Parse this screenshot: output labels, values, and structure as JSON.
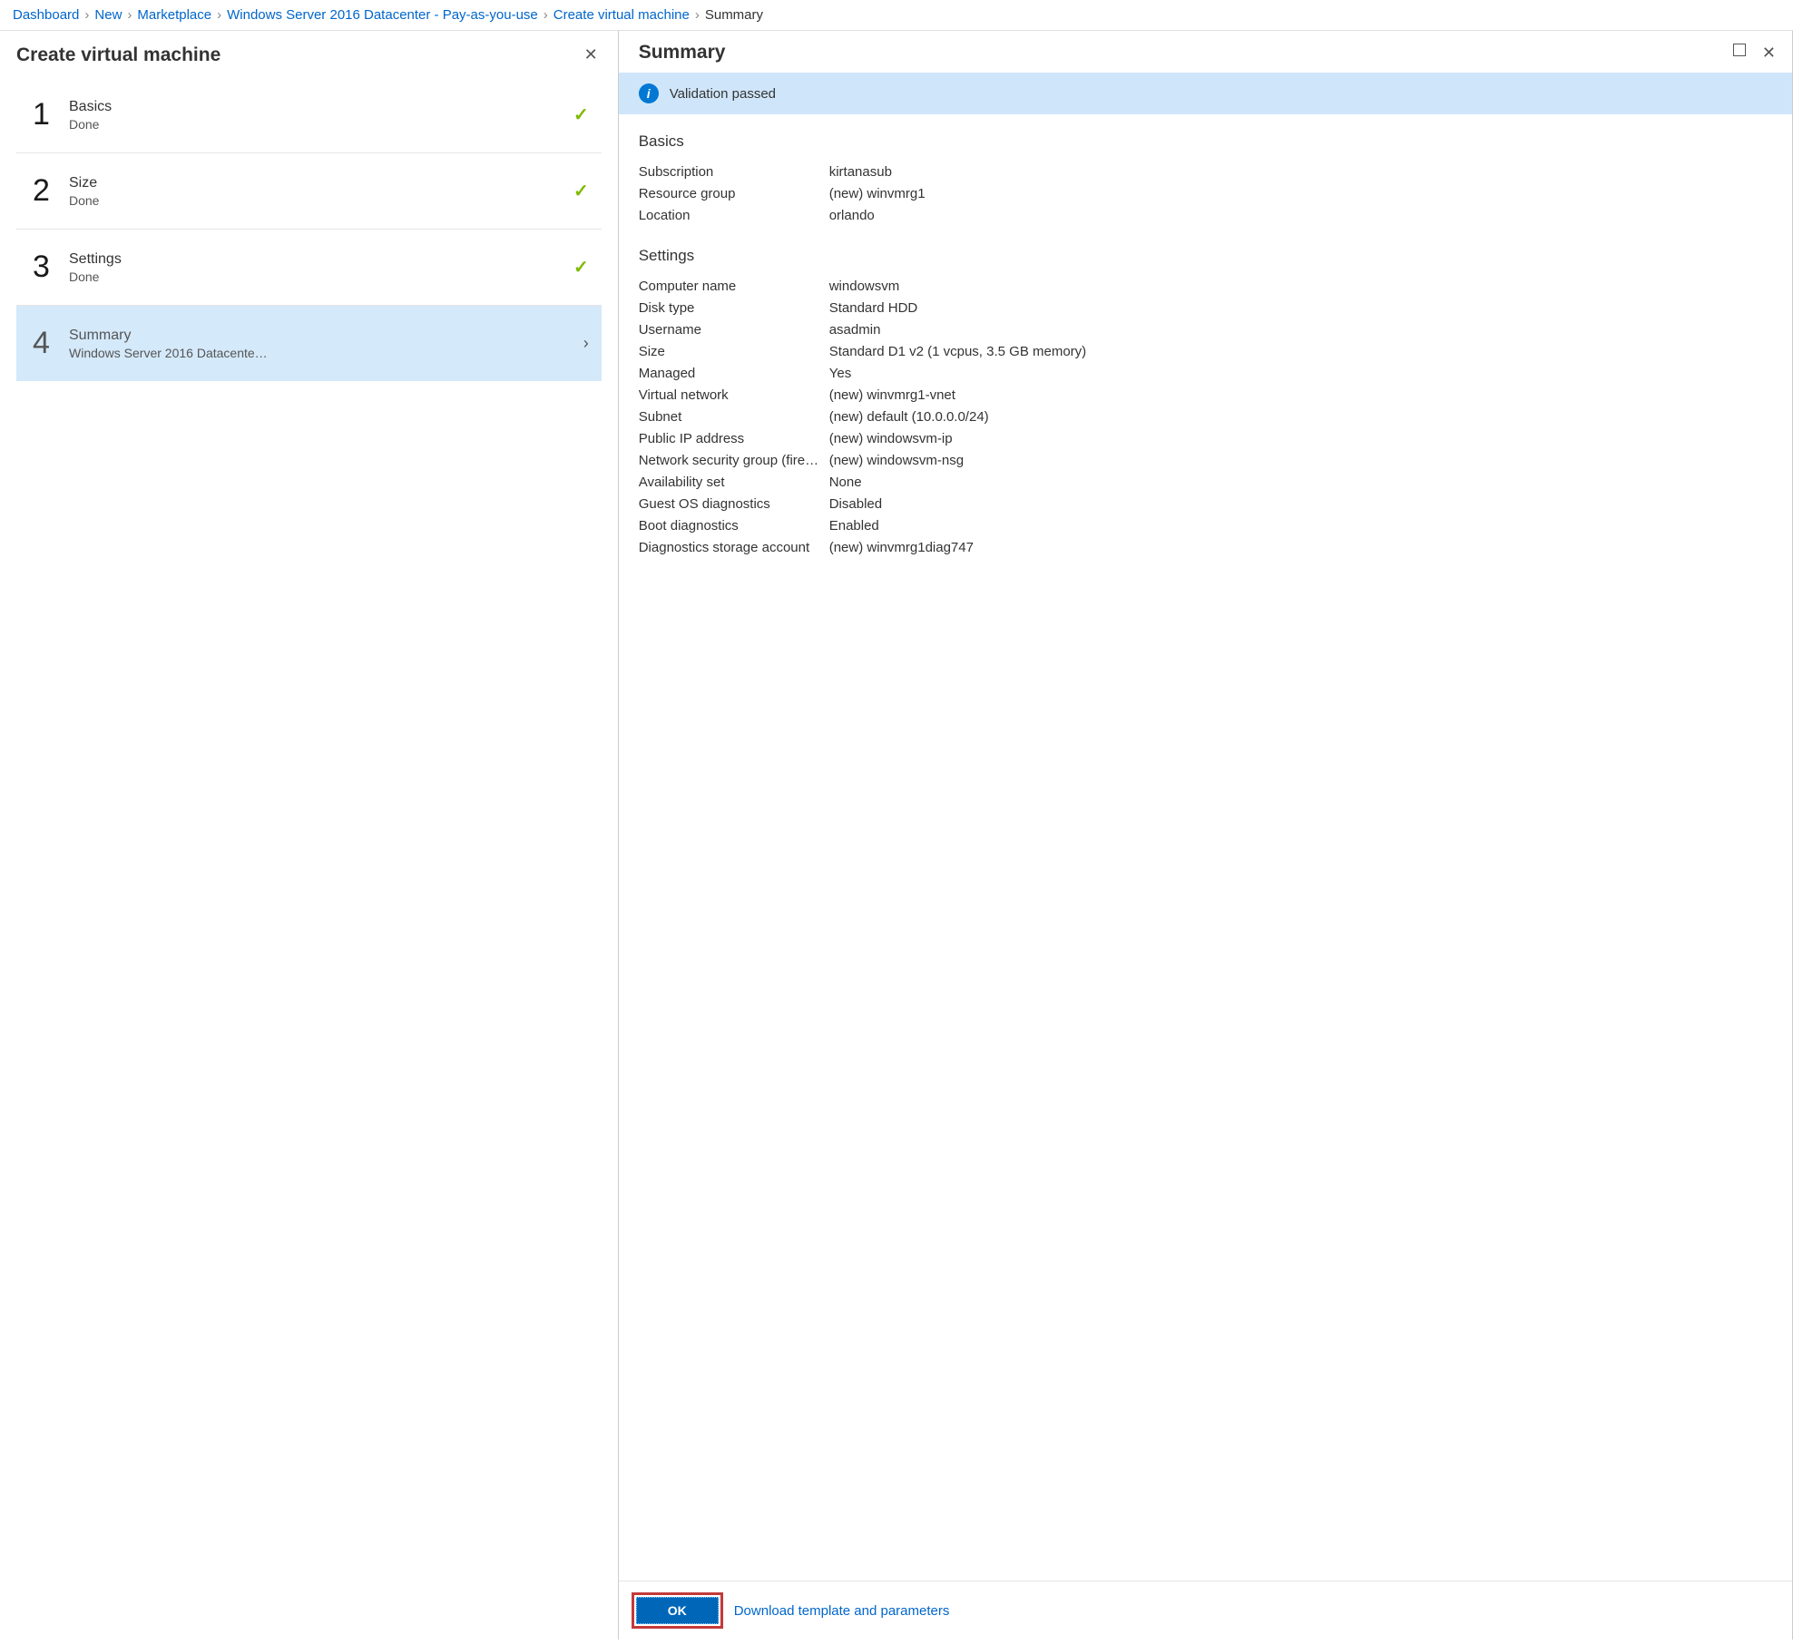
{
  "breadcrumb": {
    "items": [
      {
        "label": "Dashboard",
        "link": true
      },
      {
        "label": "New",
        "link": true
      },
      {
        "label": "Marketplace",
        "link": true
      },
      {
        "label": "Windows Server 2016 Datacenter - Pay-as-you-use",
        "link": true
      },
      {
        "label": "Create virtual machine",
        "link": true
      },
      {
        "label": "Summary",
        "link": false
      }
    ]
  },
  "wizard": {
    "title": "Create virtual machine",
    "steps": [
      {
        "num": "1",
        "label": "Basics",
        "status": "Done",
        "state": "done"
      },
      {
        "num": "2",
        "label": "Size",
        "status": "Done",
        "state": "done"
      },
      {
        "num": "3",
        "label": "Settings",
        "status": "Done",
        "state": "done"
      },
      {
        "num": "4",
        "label": "Summary",
        "status": "Windows Server 2016 Datacenter ...",
        "state": "active"
      }
    ]
  },
  "summary": {
    "title": "Summary",
    "validation_text": "Validation passed",
    "sections": [
      {
        "title": "Basics",
        "rows": [
          {
            "k": "Subscription",
            "v": "kirtanasub"
          },
          {
            "k": "Resource group",
            "v": "(new) winvmrg1"
          },
          {
            "k": "Location",
            "v": "orlando"
          }
        ]
      },
      {
        "title": "Settings",
        "rows": [
          {
            "k": "Computer name",
            "v": "windowsvm"
          },
          {
            "k": "Disk type",
            "v": "Standard HDD"
          },
          {
            "k": "Username",
            "v": "asadmin"
          },
          {
            "k": "Size",
            "v": "Standard D1 v2 (1 vcpus, 3.5 GB memory)"
          },
          {
            "k": "Managed",
            "v": "Yes"
          },
          {
            "k": "Virtual network",
            "v": "(new) winvmrg1-vnet"
          },
          {
            "k": "Subnet",
            "v": "(new) default (10.0.0.0/24)"
          },
          {
            "k": "Public IP address",
            "v": "(new) windowsvm-ip"
          },
          {
            "k": "Network security group (fire…",
            "v": "(new) windowsvm-nsg"
          },
          {
            "k": "Availability set",
            "v": "None"
          },
          {
            "k": "Guest OS diagnostics",
            "v": "Disabled"
          },
          {
            "k": "Boot diagnostics",
            "v": "Enabled"
          },
          {
            "k": "Diagnostics storage account",
            "v": "(new) winvmrg1diag747"
          }
        ]
      }
    ],
    "ok_label": "OK",
    "download_label": "Download template and parameters"
  }
}
